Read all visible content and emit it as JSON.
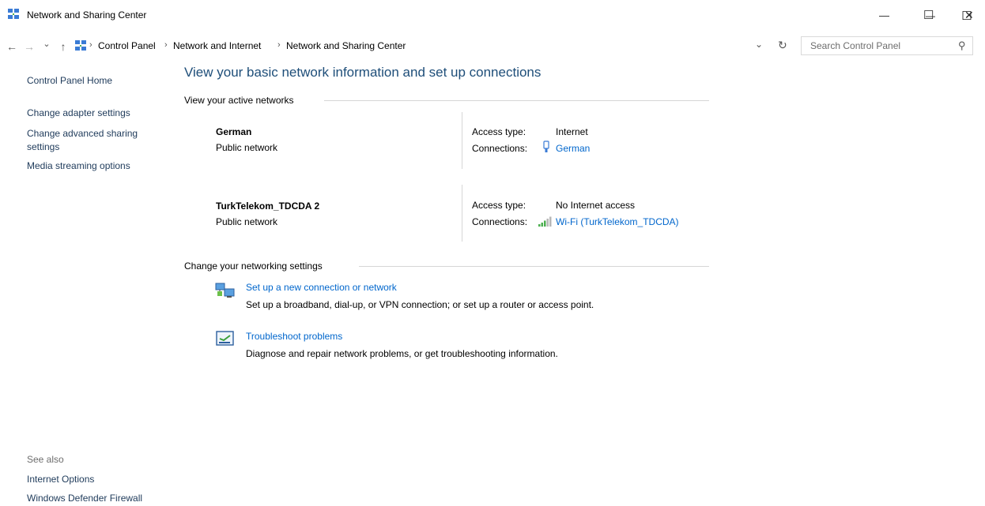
{
  "window": {
    "title": "Network and Sharing Center",
    "minimize_glyph": "—",
    "maximize_glyph": "☐",
    "close_glyph": "✕"
  },
  "address_bar": {
    "back_glyph": "←",
    "forward_glyph": "→",
    "recent_glyph": "⌄",
    "up_glyph": "↑",
    "breadcrumbs": [
      "Control Panel",
      "Network and Internet",
      "Network and Sharing Center"
    ],
    "separator": "›",
    "dropdown_glyph": "⌄",
    "refresh_glyph": "↻",
    "search_placeholder": "Search Control Panel",
    "search_glyph": "⚲"
  },
  "sidebar": {
    "home": "Control Panel Home",
    "links": [
      "Change adapter settings",
      "Change advanced sharing settings",
      "Media streaming options"
    ],
    "see_also_label": "See also",
    "see_also": [
      "Internet Options",
      "Windows Defender Firewall"
    ]
  },
  "main": {
    "heading": "View your basic network information and set up connections",
    "active_networks_label": "View your active networks",
    "networks": [
      {
        "name": "German",
        "type": "Public network",
        "access_label": "Access type:",
        "access_value": "Internet",
        "connections_label": "Connections:",
        "connection_name": "German",
        "connection_icon": "usb-modem-icon"
      },
      {
        "name": "TurkTelekom_TDCDA 2",
        "type": "Public network",
        "access_label": "Access type:",
        "access_value": "No Internet access",
        "connections_label": "Connections:",
        "connection_name": "Wi-Fi (TurkTelekom_TDCDA)",
        "connection_icon": "wifi-signal-icon"
      }
    ],
    "settings_label": "Change your networking settings",
    "tasks": [
      {
        "title": "Set up a new connection or network",
        "desc": "Set up a broadband, dial-up, or VPN connection; or set up a router or access point.",
        "icon": "new-connection-icon"
      },
      {
        "title": "Troubleshoot problems",
        "desc": "Diagnose and repair network problems, or get troubleshooting information.",
        "icon": "troubleshoot-icon"
      }
    ]
  },
  "colors": {
    "heading": "#1e4e79",
    "link": "#0066cc",
    "rule": "#d6d6d6"
  }
}
